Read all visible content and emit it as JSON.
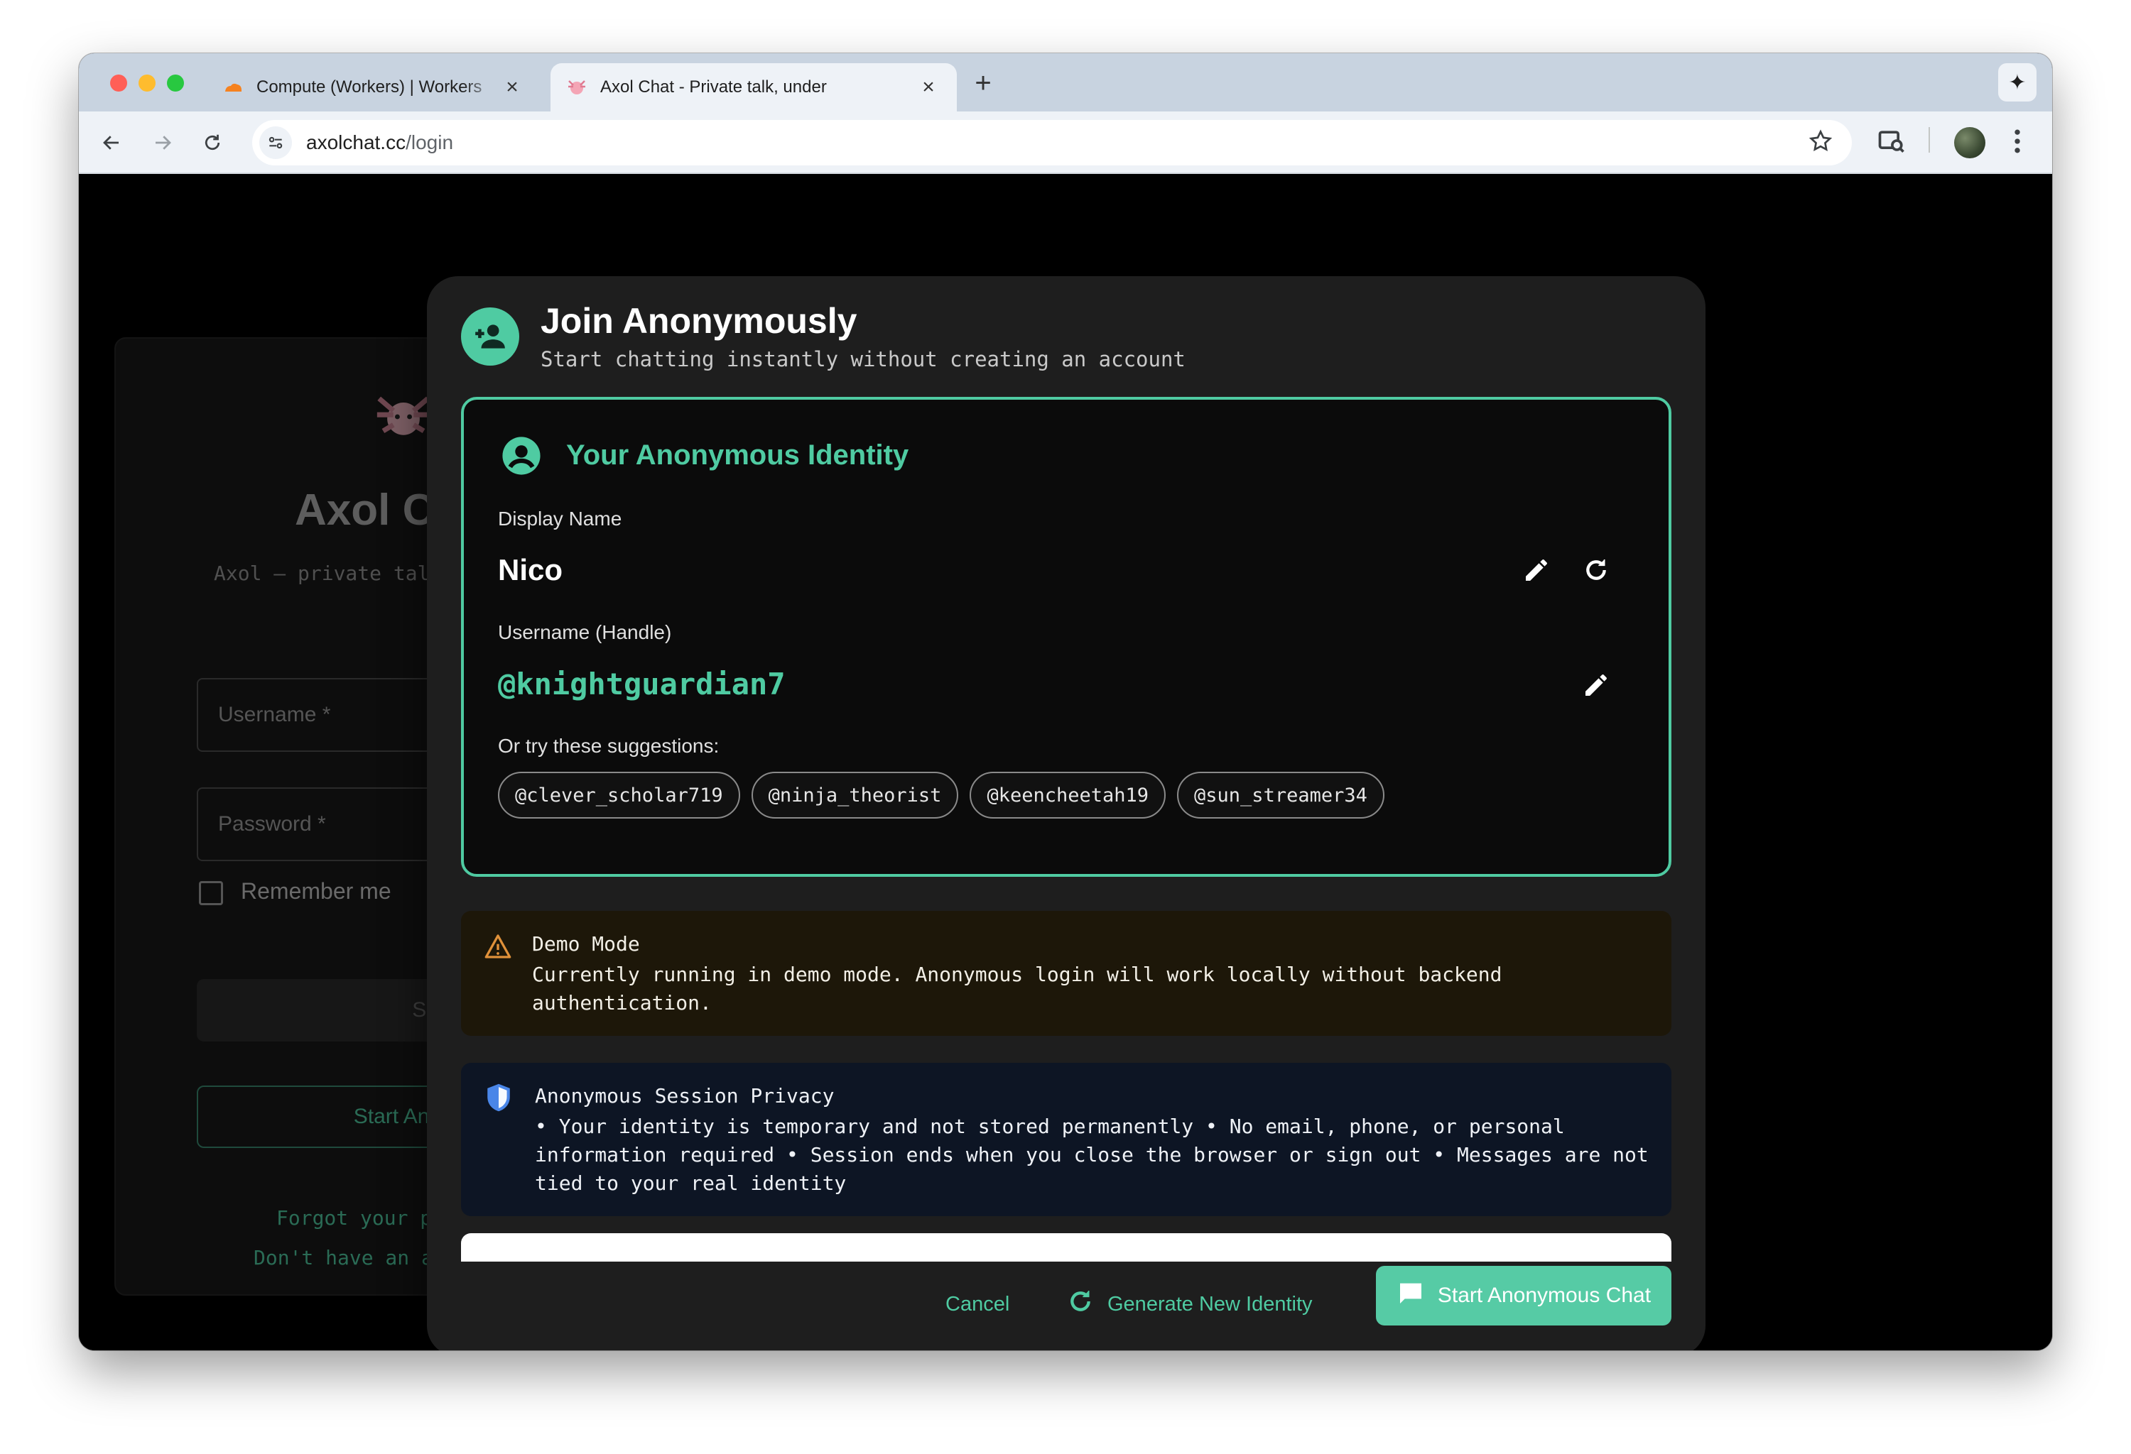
{
  "browser": {
    "tabs": [
      {
        "title": "Compute (Workers) | Workers",
        "active": false
      },
      {
        "title": "Axol Chat - Private talk, under",
        "active": true
      }
    ],
    "url_host": "axolchat.cc",
    "url_path": "/login"
  },
  "login": {
    "title": "Axol C",
    "tagline": "Axol – private talk,",
    "username_placeholder": "Username *",
    "password_placeholder": "Password *",
    "remember_label": "Remember me",
    "signin_label": "Sign In",
    "anon_label": "Start Anonymous C",
    "forgot_label": "Forgot your p",
    "noaccount_label": "Don't have an acc"
  },
  "modal": {
    "title": "Join Anonymously",
    "subtitle": "Start chatting instantly without creating an account",
    "identity": {
      "heading": "Your Anonymous Identity",
      "display_name_label": "Display Name",
      "display_name": "Nico",
      "username_label": "Username (Handle)",
      "username": "@knightguardian7",
      "suggestions_label": "Or try these suggestions:",
      "suggestions": [
        "@clever_scholar719",
        "@ninja_theorist",
        "@keencheetah19",
        "@sun_streamer34"
      ]
    },
    "demo": {
      "title": "Demo Mode",
      "text": "Currently running in demo mode. Anonymous login will work locally without backend authentication."
    },
    "privacy": {
      "title": "Anonymous Session Privacy",
      "text": "• Your identity is temporary and not stored permanently • No email, phone, or personal information required • Session ends when you close the browser or sign out • Messages are not tied to your real identity"
    },
    "actions": {
      "cancel": "Cancel",
      "generate": "Generate New Identity",
      "start": "Start Anonymous Chat"
    }
  },
  "colors": {
    "accent": "#4fcba2",
    "warning": "#e0913a",
    "info": "#4a86e8"
  }
}
